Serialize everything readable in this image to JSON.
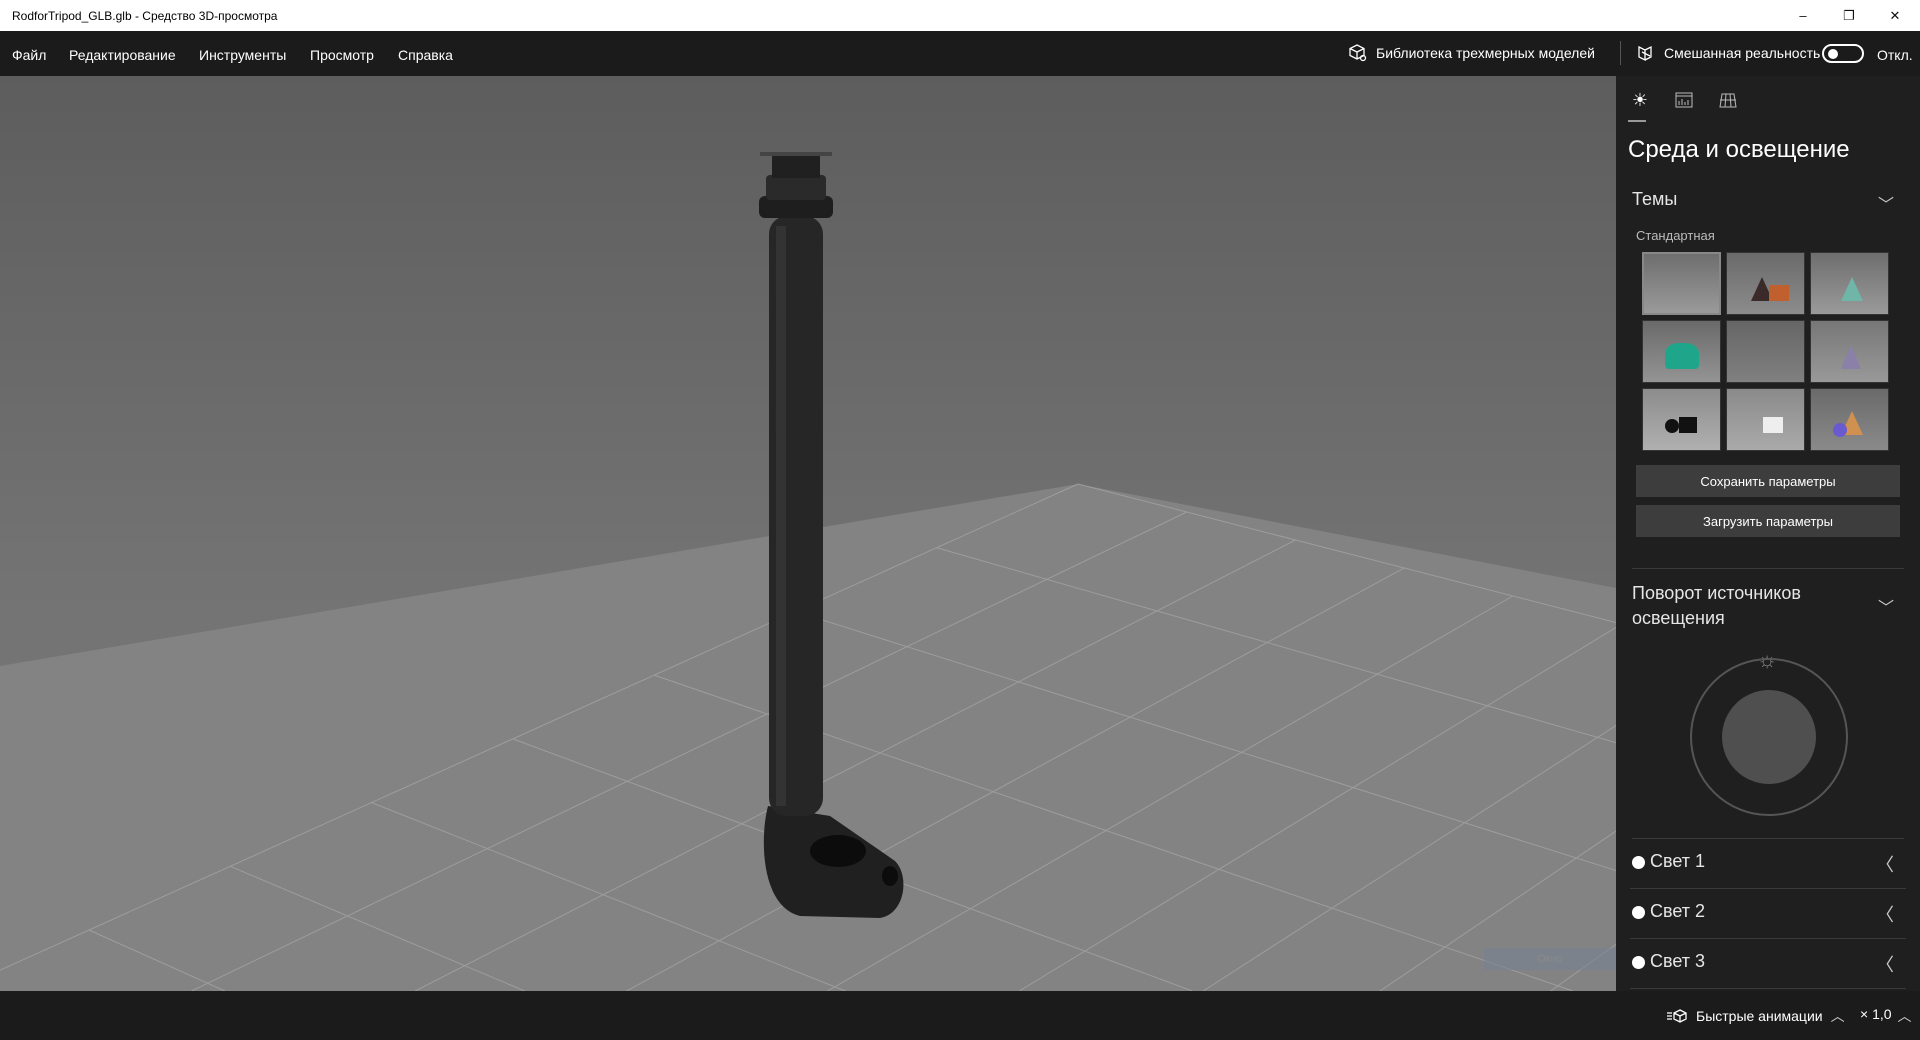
{
  "window": {
    "title": "RodforTripod_GLB.glb - Средство 3D-просмотра",
    "minimize": "–",
    "restore": "❐",
    "close": "✕"
  },
  "menu": [
    "Файл",
    "Редактирование",
    "Инструменты",
    "Просмотр",
    "Справка"
  ],
  "header": {
    "library": "Библиотека трехмерных моделей",
    "mixed_reality": "Смешанная реальность",
    "toggle_state": "Откл."
  },
  "panel": {
    "title": "Среда и освещение",
    "themes": {
      "label": "Темы",
      "group": "Стандартная",
      "selected": 0,
      "count": 9
    },
    "save": "Сохранить параметры",
    "load": "Загрузить параметры",
    "rotation": {
      "label": "Поворот источников освещения"
    },
    "lights": [
      "Свет 1",
      "Свет 2",
      "Свет 3"
    ]
  },
  "viewport": {
    "tooltip": "Окно"
  },
  "bottom": {
    "animations": "Быстрые анимации",
    "speed": "× 1,0"
  }
}
